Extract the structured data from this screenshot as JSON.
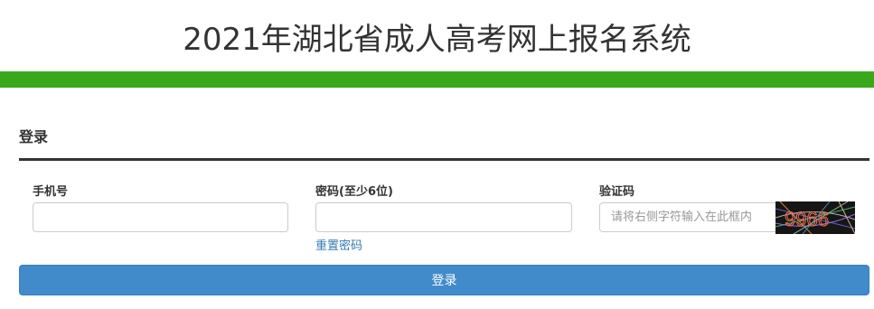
{
  "header": {
    "title": "2021年湖北省成人高考网上报名系统",
    "bar_color": "#3aa81c"
  },
  "login": {
    "heading": "登录",
    "phone_label": "手机号",
    "phone_value": "",
    "password_label": "密码(至少6位)",
    "password_value": "",
    "reset_password_link": "重置密码",
    "captcha_label": "验证码",
    "captcha_placeholder": "请将右侧字符输入在此框内",
    "captcha_value": "",
    "captcha_image_text": "9966",
    "submit_label": "登录",
    "button_color": "#428bca",
    "link_color": "#337ab7"
  }
}
